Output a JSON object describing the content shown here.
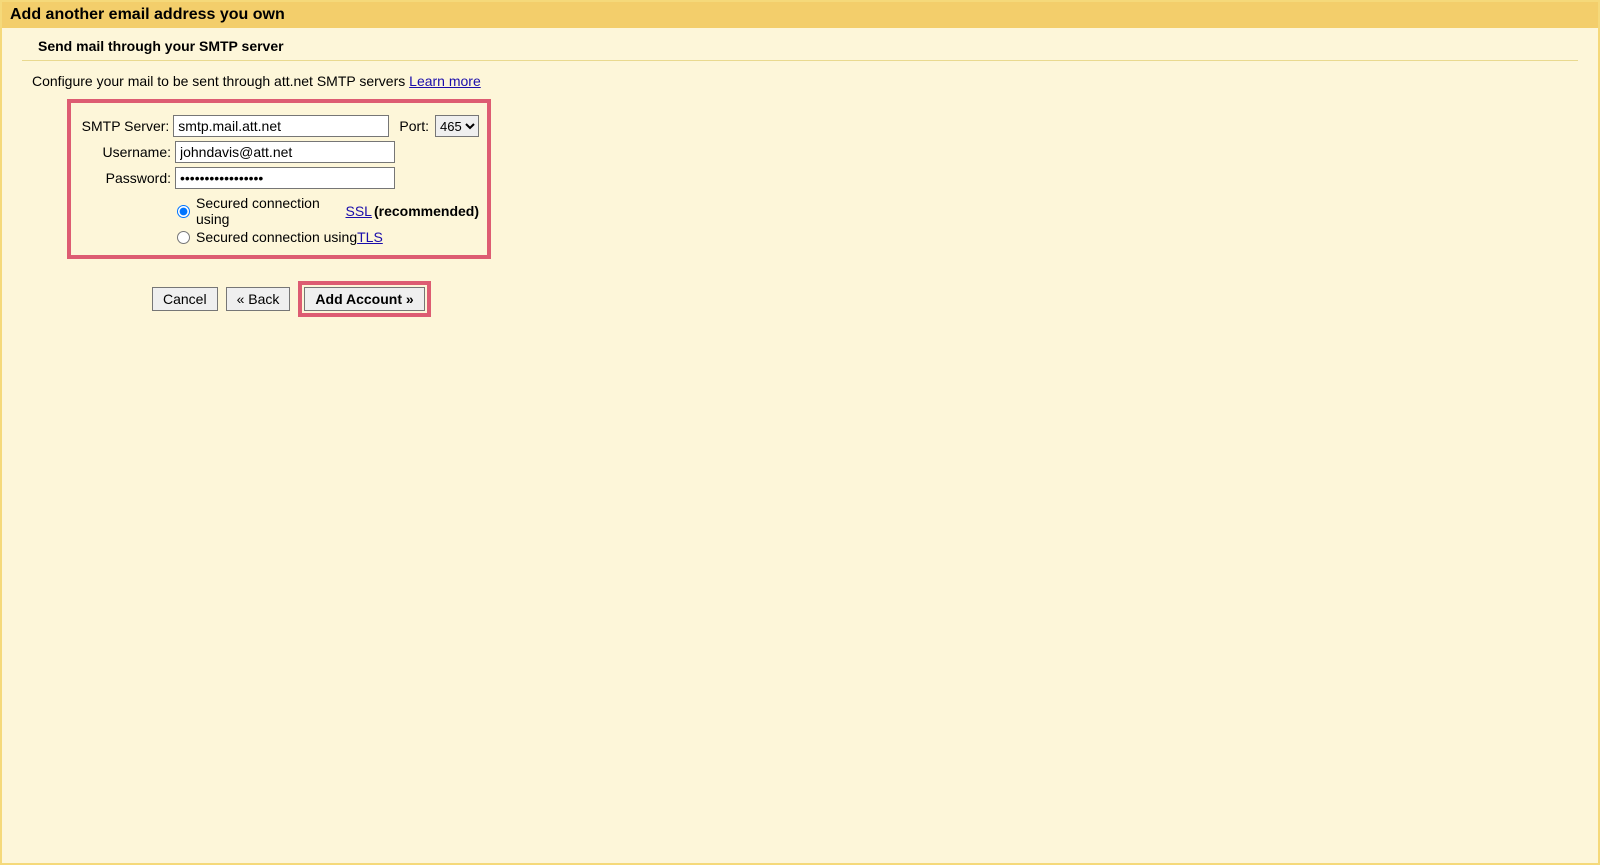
{
  "title": "Add another email address you own",
  "subtitle": "Send mail through your SMTP server",
  "instruction": {
    "text": "Configure your mail to be sent through att.net SMTP servers ",
    "link": "Learn more"
  },
  "form": {
    "smtp_label": "SMTP Server:",
    "smtp_value": "smtp.mail.att.net",
    "port_label": "Port:",
    "port_value": "465",
    "username_label": "Username:",
    "username_value": "johndavis@att.net",
    "password_label": "Password:",
    "password_value": "•••••••••••••••••"
  },
  "security": {
    "ssl_prefix": "Secured connection using ",
    "ssl_link": "SSL",
    "ssl_suffix": "(recommended)",
    "tls_prefix": "Secured connection using ",
    "tls_link": "TLS"
  },
  "buttons": {
    "cancel": "Cancel",
    "back": "« Back",
    "add_account": "Add Account »"
  }
}
